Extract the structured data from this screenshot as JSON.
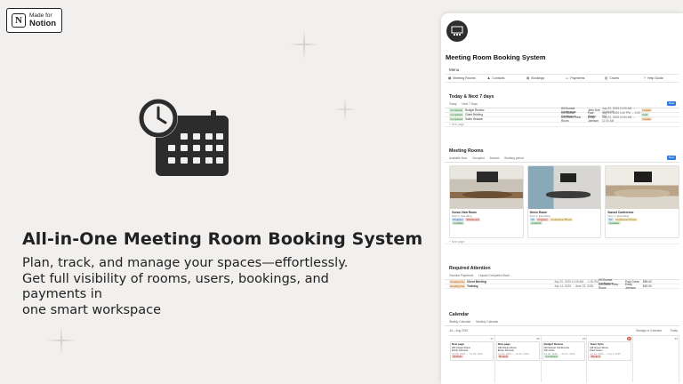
{
  "badge": {
    "line1": "Made for",
    "line2": "Notion",
    "logo_letter": "N"
  },
  "hero": {
    "headline": "All-in-One Meeting Room Booking System",
    "line1": "Plan, track, and manage your spaces—effortlessly.",
    "line2": "Get full visibility of rooms, users, bookings, and payments in",
    "line3": "one smart workspace"
  },
  "panel": {
    "title": "Meeting Room Booking System",
    "menu_label": "Menu",
    "menu": [
      {
        "label": "Meeting Rooms",
        "icon": "grid-icon"
      },
      {
        "label": "Contacts",
        "icon": "person-icon"
      },
      {
        "label": "Bookings",
        "icon": "calendar-icon"
      },
      {
        "label": "Payments",
        "icon": "card-icon"
      },
      {
        "label": "Charts",
        "icon": "chart-icon"
      },
      {
        "label": "Help Guide",
        "icon": "help-icon"
      }
    ],
    "today": {
      "heading": "Today & Next 7 days",
      "tabs": [
        "Today",
        "Next 7 Days"
      ],
      "new_label": "New",
      "rows": [
        {
          "status": "Completed",
          "name": "Budget Review",
          "room": "Hill Sunset Conference",
          "person": "John Doe",
          "date": "July 20, 2025 10:00 AM → 11:00 AM",
          "pay": "Unpaid"
        },
        {
          "status": "Completed",
          "name": "Client Briefing",
          "room": "Hill Sunset Conference",
          "person": "Paul Green",
          "date": "July 21, 2025 1:00 PM → 2:00 PM",
          "pay": "Paid"
        },
        {
          "status": "Completed",
          "name": "Sales Session",
          "room": "Hill Green View Room",
          "person": "Emily Johnson",
          "date": "July 22, 2025 10:00 AM → 11:00 AM",
          "pay": "Unpaid"
        }
      ],
      "new_page": "+ New page"
    },
    "rooms": {
      "heading": "Meeting Rooms",
      "tabs": [
        "Available Now",
        "Occupied",
        "Booked",
        "Booking period"
      ],
      "new_label": "New",
      "cards": [
        {
          "name": "Ocean View Room",
          "floor": "Floor 3, Sea Wing",
          "tags": [
            "Projector",
            "Whiteboard"
          ],
          "status": "Available"
        },
        {
          "name": "Green Room",
          "floor": "Floor 2, East Wing",
          "tags": [
            "TV",
            "Projector",
            "Conference Phone"
          ],
          "status": "Available"
        },
        {
          "name": "Sunset Conference",
          "floor": "Floor 1, West Wing",
          "tags": [
            "TV",
            "Conference Phone"
          ],
          "status": "Available"
        }
      ],
      "new_page": "+ New page"
    },
    "attention": {
      "heading": "Required Attention",
      "tabs": [
        "Overdue Payments",
        "Unpaid Completed Book..."
      ],
      "rows": [
        {
          "status": "Pending Pay",
          "name": "Client Briefing",
          "date": "July 20, 2025 11:00 AM → 1:00 PM",
          "room": "Hill Sunset Conference",
          "person": "Paul Green",
          "amount": "$90.00"
        },
        {
          "status": "Pending Pay",
          "name": "Training",
          "date": "July 14, 2025 → June 22, 2025",
          "room": "Hill Green View Room",
          "person": "Emily Johnson",
          "amount": "$40.00"
        }
      ]
    },
    "calendar": {
      "heading": "Calendar",
      "tabs": [
        "Weekly Calendar",
        "Monthly Calendar"
      ],
      "month": "Jul – Aug 2025",
      "manage": "Manage in Calendar",
      "today_label": "Today",
      "days": [
        "27",
        "28",
        "29",
        "30",
        "31"
      ],
      "events": [
        {
          "day": 0,
          "title": "New page",
          "lines": [
            "Hill Ocean Room",
            "Emily Johnson",
            "Jul 28, 2025 → Jul 29, 2025"
          ],
          "tag": "Booked"
        },
        {
          "day": 1,
          "title": "New page",
          "lines": [
            "Hill Ocean Room",
            "Emily Johnson",
            "Jul 29, 2025 → Jul 30, 2025"
          ],
          "tag": "Booked"
        },
        {
          "day": 2,
          "title": "Budget Review",
          "lines": [
            "Hill Sunset Conference",
            "John Doe",
            "Jul 30, 2025 → Jul 31, 2025"
          ],
          "tag": "Completed"
        },
        {
          "day": 3,
          "title": "Team Sync",
          "lines": [
            "Hill Green Room",
            "Paul Green",
            "Jul 31, 2025 → Aug 1, 2025"
          ],
          "tag": "Booked"
        }
      ]
    }
  }
}
